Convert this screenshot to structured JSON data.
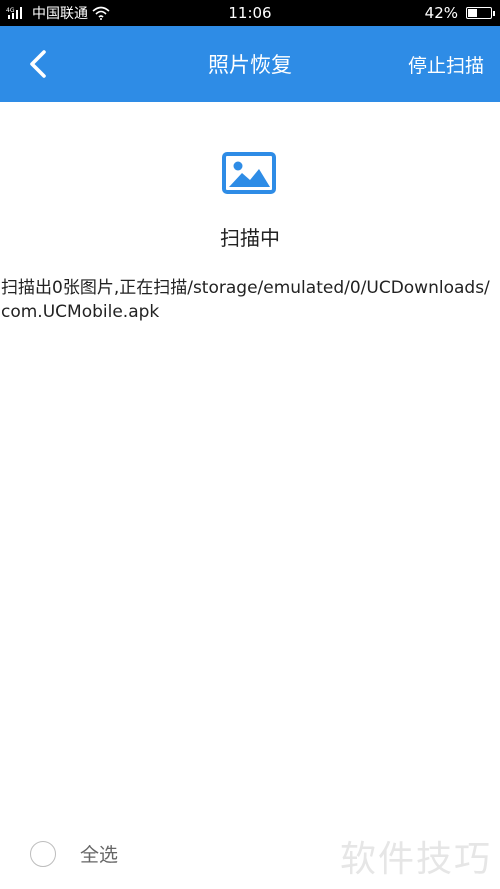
{
  "status_bar": {
    "network": "4G",
    "carrier": "中国联通",
    "time": "11:06",
    "battery_percent": "42%",
    "battery_level": 0.42
  },
  "header": {
    "back_icon": "chevron-left-icon",
    "title": "照片恢复",
    "stop_label": "停止扫描",
    "color": "#2e8ce6"
  },
  "main": {
    "image_icon": "image-icon",
    "icon_color": "#2e8ce6",
    "status": "扫描中",
    "detail": "扫描出0张图片,正在扫描/storage/emulated/0/UCDownloads/com.UCMobile.apk"
  },
  "footer": {
    "select_all_label": "全选",
    "watermark": "软件技巧"
  }
}
